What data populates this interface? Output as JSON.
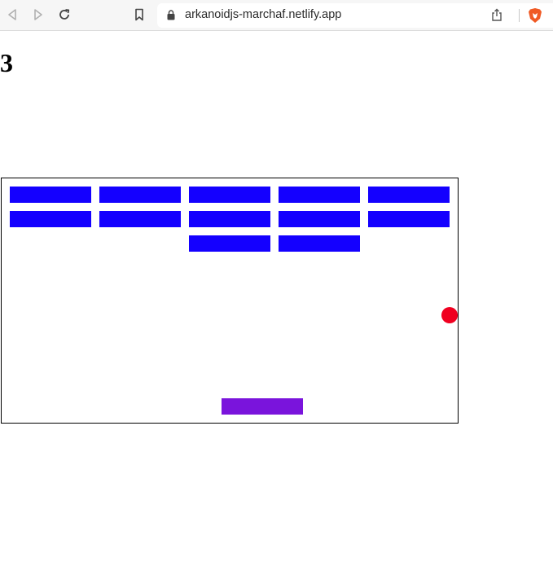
{
  "browser": {
    "url": "arkanoidjs-marchaf.netlify.app",
    "icons": [
      "back-icon",
      "forward-icon",
      "reload-icon",
      "bookmark-icon",
      "lock-icon",
      "share-icon",
      "brave-shield-icon"
    ]
  },
  "game": {
    "score": "3",
    "colors": {
      "brick": "#1400ff",
      "ball": "#f00020",
      "paddle": "#7a14dc",
      "border": "#000000"
    },
    "bricks": {
      "rows": [
        [
          true,
          true,
          true,
          true,
          true
        ],
        [
          true,
          true,
          true,
          true,
          true
        ],
        [
          false,
          false,
          true,
          true,
          false
        ]
      ]
    }
  }
}
